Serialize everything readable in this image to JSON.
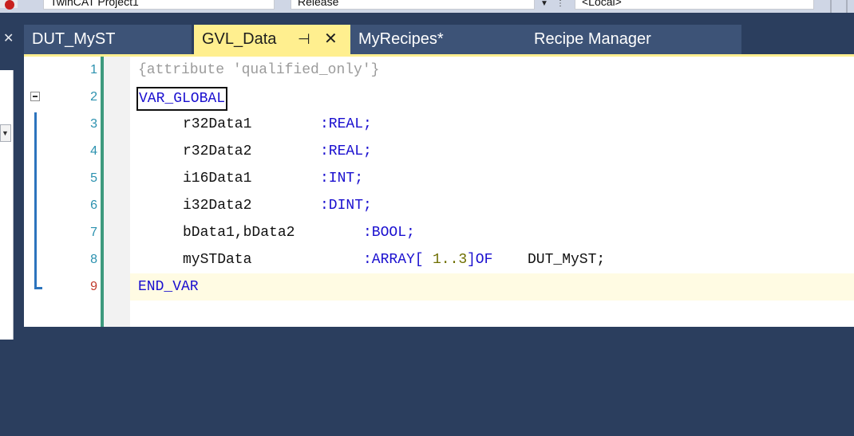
{
  "toolbar": {
    "combo_project": "TwinCAT Project1",
    "combo_release": "Release",
    "combo_target": "<Local>",
    "drop_icon": "dropdown-arrow-icon",
    "dots_icon": "more-icon"
  },
  "tabs": [
    {
      "label": "DUT_MyST",
      "active": false
    },
    {
      "label": "GVL_Data",
      "active": true,
      "pin_glyph": "⊣",
      "close_glyph": "✕"
    },
    {
      "label": "MyRecipes*",
      "active": false
    },
    {
      "label": "Recipe Manager",
      "active": false
    }
  ],
  "colors": {
    "tab_active": "#ffef8f",
    "tab_inactive": "#3d5377",
    "keyword": "#1a0fcf",
    "comment": "#9b9b9b",
    "line_number": "#2b91af",
    "current_line_number": "#c0392b",
    "current_line_bg": "#fffbe3"
  },
  "editor": {
    "line_numbers": [
      "1",
      "2",
      "3",
      "4",
      "5",
      "6",
      "7",
      "8",
      "9"
    ],
    "current_line": 9,
    "code": {
      "l1": "{attribute 'qualified_only'}",
      "l2": "VAR_GLOBAL",
      "l3_name": "r32Data1",
      "l3_type": ":REAL;",
      "l4_name": "r32Data2",
      "l4_type": ":REAL;",
      "l5_name": "i16Data1",
      "l5_type": ":INT;",
      "l6_name": "i32Data2",
      "l6_type": ":DINT;",
      "l7_name": "bData1,bData2",
      "l7_type": ":BOOL;",
      "l8_name": "mySTData",
      "l8_type_a": ":ARRAY[",
      "l8_range": "1..3",
      "l8_type_b": "]OF",
      "l8_type_c": "DUT_MyST;",
      "l9": "END_VAR"
    }
  }
}
